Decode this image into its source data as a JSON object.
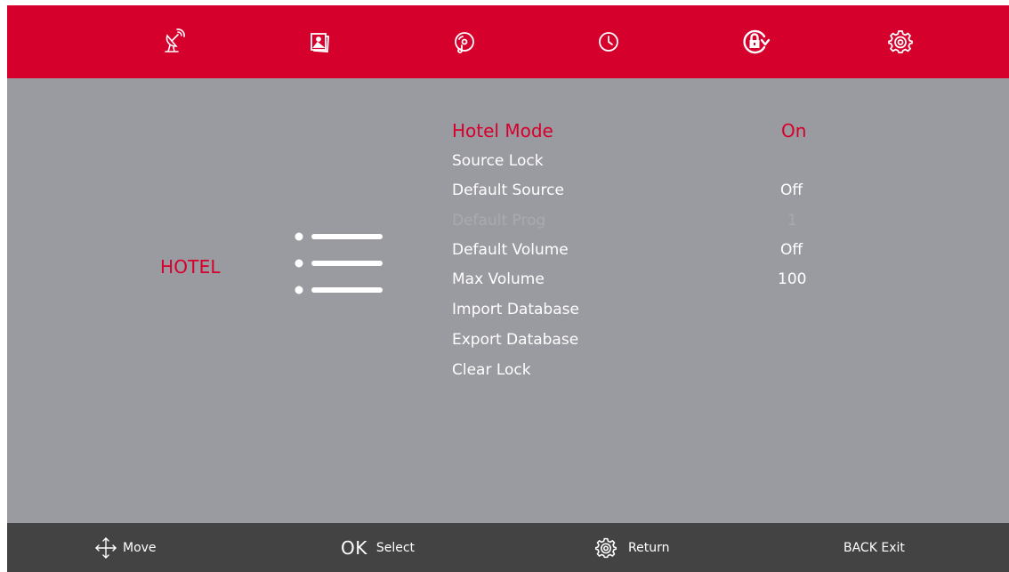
{
  "top_icons": [
    "satellite-dish-icon",
    "picture-icon",
    "sound-icon",
    "clock-icon",
    "lock-icon",
    "settings-icon"
  ],
  "section": {
    "title": "HOTEL"
  },
  "menu": [
    {
      "label": "Hotel Mode",
      "value": "On",
      "state": "selected"
    },
    {
      "label": "Source Lock",
      "value": "",
      "state": "normal"
    },
    {
      "label": "Default Source",
      "value": "Off",
      "state": "normal"
    },
    {
      "label": "Default Prog",
      "value": "1",
      "state": "disabled"
    },
    {
      "label": "Default Volume",
      "value": "Off",
      "state": "normal"
    },
    {
      "label": "Max Volume",
      "value": "100",
      "state": "normal"
    },
    {
      "label": "Import Database",
      "value": "",
      "state": "normal"
    },
    {
      "label": "Export Database",
      "value": "",
      "state": "normal"
    },
    {
      "label": "Clear Lock",
      "value": "",
      "state": "normal"
    }
  ],
  "footer": {
    "move_label": "Move",
    "ok_key": "OK",
    "select_label": "Select",
    "return_label": "Return",
    "exit_label": "BACK Exit"
  },
  "colors": {
    "accent": "#d6002d",
    "panel": "#9a9aa1",
    "footer": "#434343",
    "disabled_text": "#a9a9ae"
  }
}
